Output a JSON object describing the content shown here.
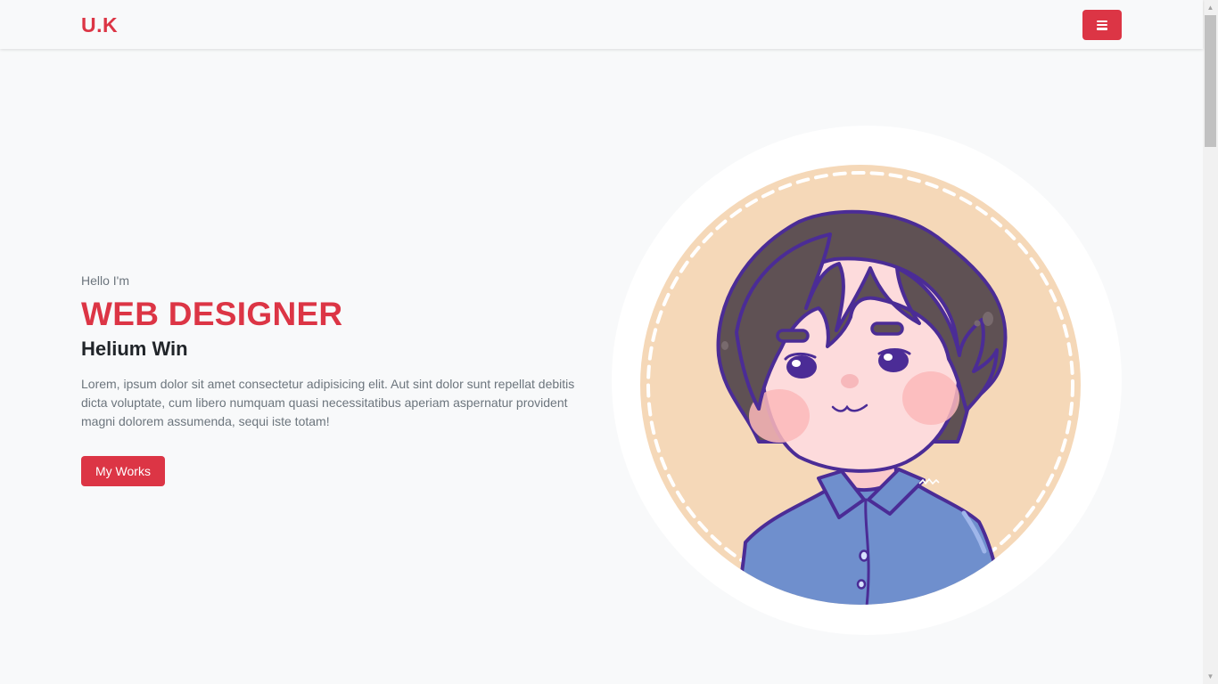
{
  "navbar": {
    "brand": "U.K",
    "menu_icon": "hamburger-menu-icon"
  },
  "hero": {
    "greeting": "Hello I'm",
    "role": "WEB DESIGNER",
    "name": "Helium Win",
    "description": "Lorem, ipsum dolor sit amet consectetur adipisicing elit. Aut sint dolor sunt repellat debitis dicta voluptate, cum libero numquam quasi necessitatibus aperiam aspernatur provident magni dolorem assumenda, sequi iste totam!",
    "button_label": "My Works"
  },
  "avatar": {
    "description_icon": "cartoon-avatar-illustration"
  },
  "colors": {
    "accent": "#dc3545",
    "background": "#f8f9fa",
    "text_dark": "#212529",
    "text_muted": "#6c757d",
    "avatar_bg": "#f5d8b8",
    "hair": "#5f5154",
    "outline": "#4b2c96",
    "shirt": "#6f8fcd",
    "skin": "#fddbdc"
  }
}
